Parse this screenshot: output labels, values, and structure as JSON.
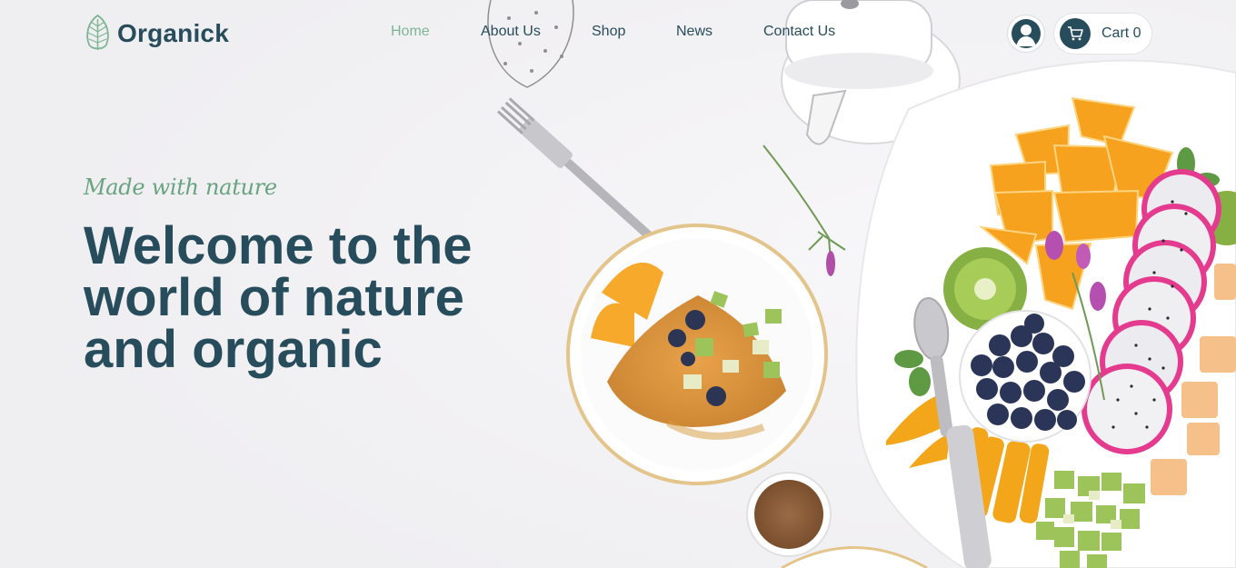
{
  "brand": {
    "name": "Organick"
  },
  "nav": {
    "items": [
      {
        "label": "Home",
        "active": true
      },
      {
        "label": "About Us",
        "active": false
      },
      {
        "label": "Shop",
        "active": false
      },
      {
        "label": "News",
        "active": false
      },
      {
        "label": "Contact Us",
        "active": false
      }
    ]
  },
  "header": {
    "account_icon": "user-icon",
    "cart_icon": "cart-icon",
    "cart_label": "Cart 0"
  },
  "hero": {
    "tagline": "Made with nature",
    "title": "Welcome to the world of nature and organic"
  },
  "colors": {
    "primary": "#274c5b",
    "accent": "#7eb693",
    "tagline": "#68a47f",
    "background": "#f3f2f4"
  }
}
